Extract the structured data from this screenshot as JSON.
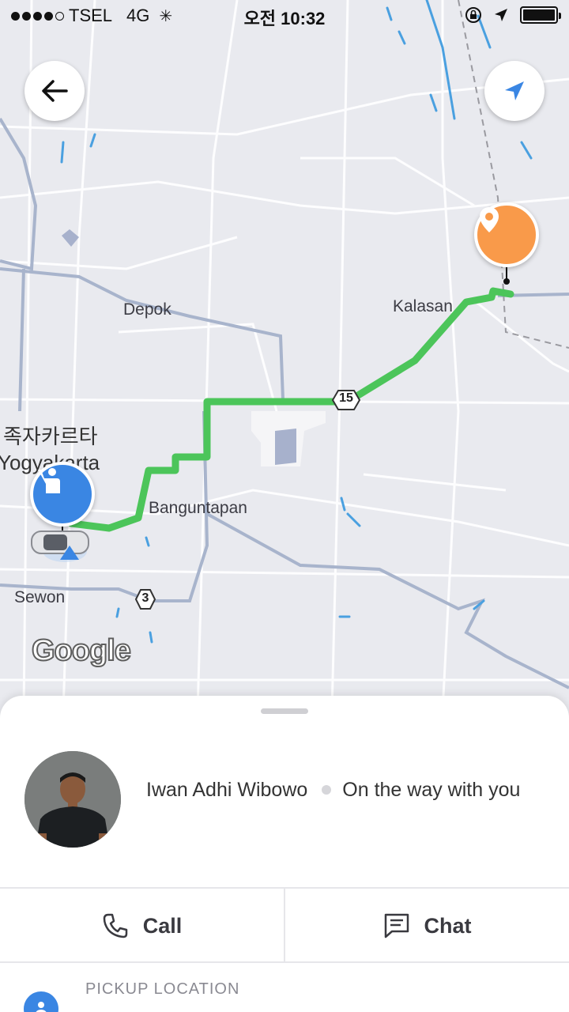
{
  "status_bar": {
    "carrier": "TSEL",
    "network": "4G",
    "time": "오전 10:32"
  },
  "map": {
    "labels": {
      "depok": "Depok",
      "kalasan": "Kalasan",
      "yogyakarta_korean": "족자카르타",
      "yogyakarta": "Yogyakarta",
      "banguntapan": "Banguntapan",
      "sewon": "Sewon"
    },
    "road_shields": {
      "route_15": "15",
      "route_3": "3"
    },
    "route_color": "#4cc55a",
    "google_logo": "Google"
  },
  "buttons": {
    "back_icon": "arrow-left-icon",
    "my_location_icon": "navigation-arrow-icon"
  },
  "driver": {
    "name": "Iwan Adhi Wibowo",
    "status": "On the way with you"
  },
  "actions": {
    "call_label": "Call",
    "chat_label": "Chat"
  },
  "pickup": {
    "label": "PICKUP LOCATION"
  },
  "colors": {
    "accent_blue": "#3a86e3",
    "destination_orange": "#f99a4a"
  }
}
